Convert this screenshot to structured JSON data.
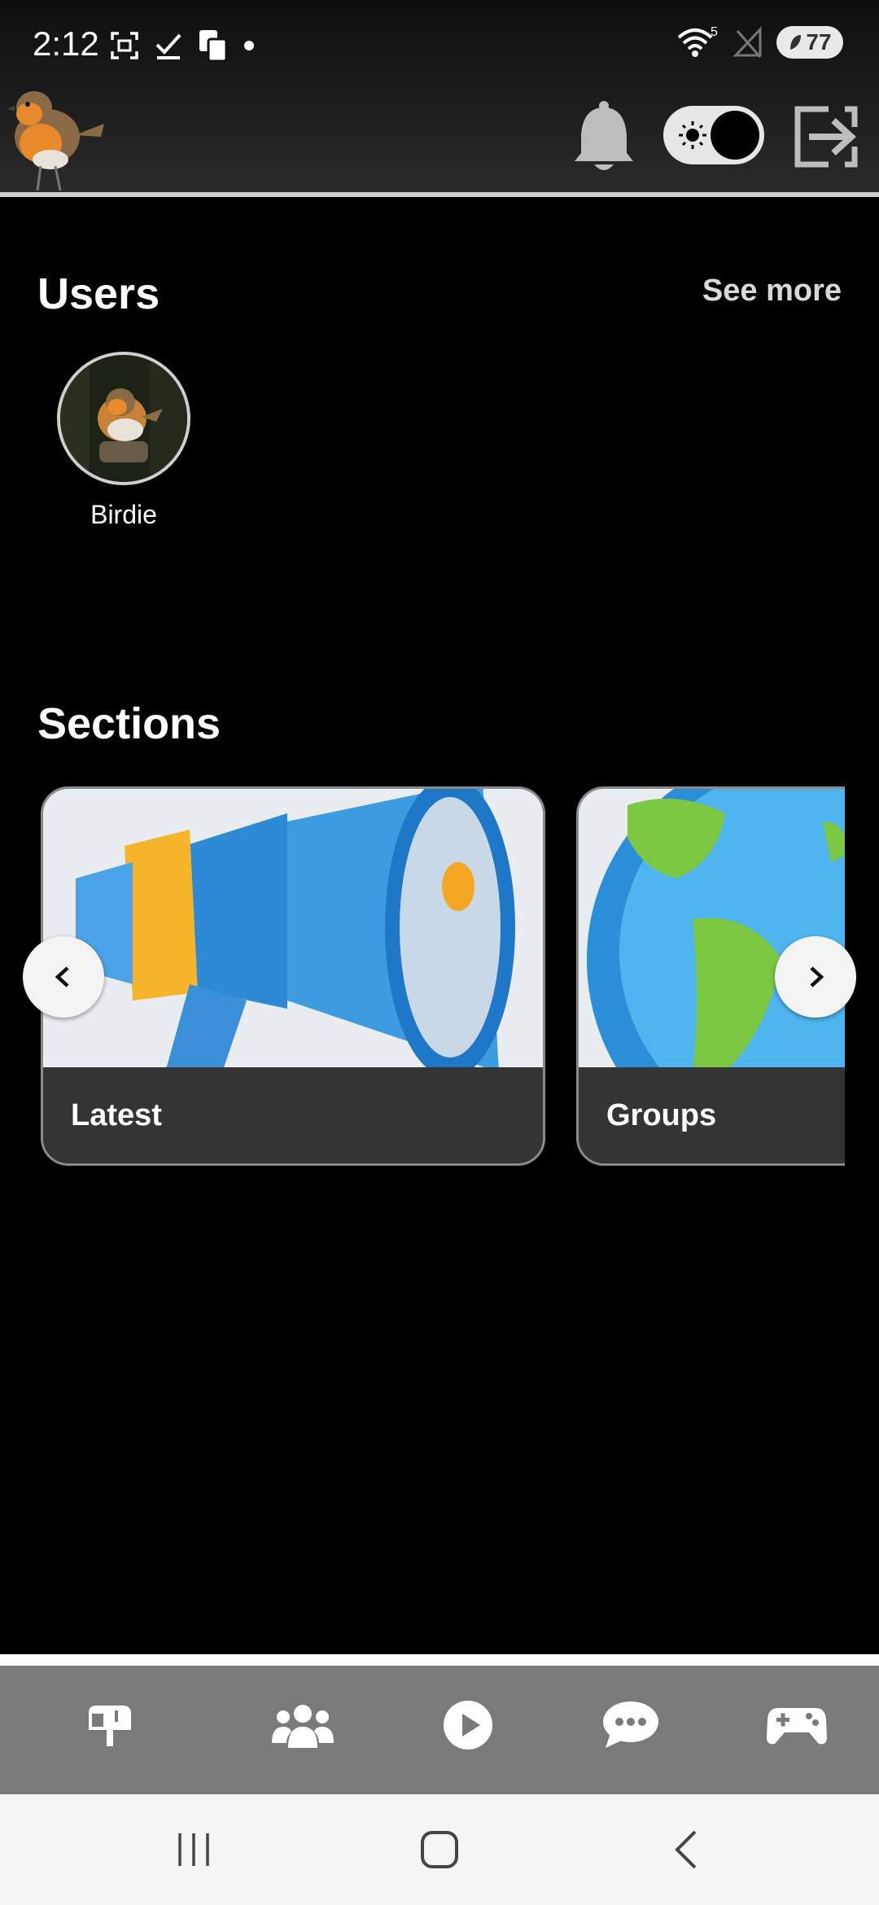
{
  "status_bar": {
    "time": "2:12",
    "wifi_superscript": "5",
    "battery": "77"
  },
  "header": {
    "logo_icon": "robin-bird-logo",
    "notifications_icon": "bell-icon",
    "theme_toggle_icon": "sun-icon",
    "logout_icon": "logout-icon"
  },
  "users": {
    "title": "Users",
    "see_more": "See more",
    "items": [
      {
        "name": "Birdie"
      }
    ]
  },
  "sections": {
    "title": "Sections",
    "cards": [
      {
        "label": "Latest",
        "image": "megaphone-image"
      },
      {
        "label": "Groups",
        "image": "globe-image"
      }
    ]
  },
  "bottom_nav": {
    "items": [
      {
        "icon": "mailbox-icon"
      },
      {
        "icon": "users-icon"
      },
      {
        "icon": "play-icon"
      },
      {
        "icon": "chat-icon"
      },
      {
        "icon": "gamepad-icon"
      }
    ]
  },
  "colors": {
    "background": "#000000",
    "header": "#222222",
    "card_footer": "#343434",
    "bottom_nav": "#7a7a7a"
  }
}
